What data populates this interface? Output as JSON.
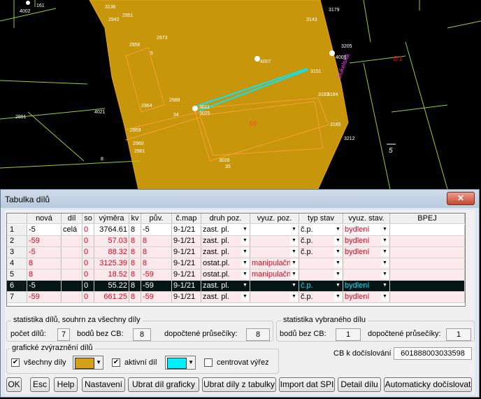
{
  "colors": {
    "parcel_fill": "#c8960a",
    "accent_cyan": "#00e8ff",
    "row_red": "#e0001a"
  },
  "map": {
    "labels": [
      "4002",
      "161",
      "3136",
      "2942",
      "2951",
      "3179",
      "3143",
      "2973",
      "2956",
      "5",
      "3205",
      "4007",
      "3151",
      "Dukelská",
      "4005",
      "6/1",
      "2988",
      "3183",
      "3184",
      "2891",
      "4021",
      "2964",
      "3011",
      "3025",
      "34",
      "59",
      "3185",
      "2959",
      "2960",
      "3212",
      "2961",
      "5",
      "3028",
      "8",
      "35",
      "8"
    ]
  },
  "dialog": {
    "title": "Tabulka dílů",
    "close_icon": "close-icon",
    "table": {
      "headers": [
        "",
        "nová",
        "díl",
        "so",
        "výměra",
        "kv",
        "pův.",
        "č.map",
        "druh poz.",
        "vyuz. poz.",
        "typ stav",
        "vyuz. stav.",
        "BPEJ"
      ],
      "rows": [
        {
          "n": "1",
          "nova": "-5",
          "dil": "celá",
          "so": "0",
          "vymera": "3764.61",
          "kv": "8",
          "puv": "-5",
          "cmap": "9-1/21",
          "druh": "zast. pl.",
          "vyuz": "",
          "typ": "č.p.",
          "vyuzs": "bydlení",
          "bpej": "",
          "style": "white"
        },
        {
          "n": "2",
          "nova": "-59",
          "dil": "",
          "so": "0",
          "vymera": "57.03",
          "kv": "8",
          "puv": "8",
          "cmap": "9-1/21",
          "druh": "zast. pl.",
          "vyuz": "",
          "typ": "č.p.",
          "vyuzs": "bydlení",
          "bpej": "",
          "style": "pink"
        },
        {
          "n": "3",
          "nova": "-5",
          "dil": "",
          "so": "0",
          "vymera": "88.32",
          "kv": "8",
          "puv": "8",
          "cmap": "9-1/21",
          "druh": "zast. pl.",
          "vyuz": "",
          "typ": "č.p.",
          "vyuzs": "bydlení",
          "bpej": "",
          "style": "pink"
        },
        {
          "n": "4",
          "nova": "8",
          "dil": "",
          "so": "0",
          "vymera": "3125.39",
          "kv": "8",
          "puv": "8",
          "cmap": "9-1/21",
          "druh": "ostat.pl.",
          "vyuz": "manipulačn",
          "typ": "",
          "vyuzs": "",
          "bpej": "",
          "style": "pink"
        },
        {
          "n": "5",
          "nova": "8",
          "dil": "",
          "so": "0",
          "vymera": "18.52",
          "kv": "8",
          "puv": "-59",
          "cmap": "9-1/21",
          "druh": "ostat.pl.",
          "vyuz": "manipulačn",
          "typ": "",
          "vyuzs": "",
          "bpej": "",
          "style": "pink"
        },
        {
          "n": "6",
          "nova": "-5",
          "dil": "",
          "so": "0",
          "vymera": "55.22",
          "kv": "8",
          "puv": "-59",
          "cmap": "9-1/21",
          "druh": "zast. pl.",
          "vyuz": "",
          "typ": "č.p.",
          "vyuzs": "bydlení",
          "bpej": "",
          "style": "selected"
        },
        {
          "n": "7",
          "nova": "-59",
          "dil": "",
          "so": "0",
          "vymera": "661.25",
          "kv": "8",
          "puv": "-59",
          "cmap": "9-1/21",
          "druh": "zast. pl.",
          "vyuz": "",
          "typ": "č.p.",
          "vyuzs": "bydlení",
          "bpej": "",
          "style": "pink"
        }
      ]
    },
    "stats_all": {
      "legend": "statistika dílů, souhrn za všechny díly",
      "count_label": "počet dílů:",
      "count": "7",
      "nocb_label": "bodů bez CB:",
      "nocb": "8",
      "calc_label": "dopočtené průsečíky:",
      "calc": "8"
    },
    "stats_sel": {
      "legend": "statistika vybraného dílu",
      "nocb_label": "bodů bez CB:",
      "nocb": "1",
      "calc_label": "dopočtené průsečíky:",
      "calc": "1"
    },
    "graphics": {
      "legend": "grafické zvýraznění dílů",
      "all_label": "všechny díly",
      "all_checked": true,
      "all_color": "#d4a017",
      "active_label": "aktivní díl",
      "active_checked": true,
      "active_color": "#00f0ff",
      "center_label": "centrovat výřez",
      "center_checked": false
    },
    "cb": {
      "label": "CB k dočíslování",
      "value": "601888003033598"
    },
    "buttons": [
      "OK",
      "Esc",
      "Help",
      "Nastavení",
      "Ubrat díl graficky",
      "Ubrat díly z tabulky",
      "Import dat SPI",
      "Detail dílu",
      "Automaticky dočíslovat"
    ]
  }
}
